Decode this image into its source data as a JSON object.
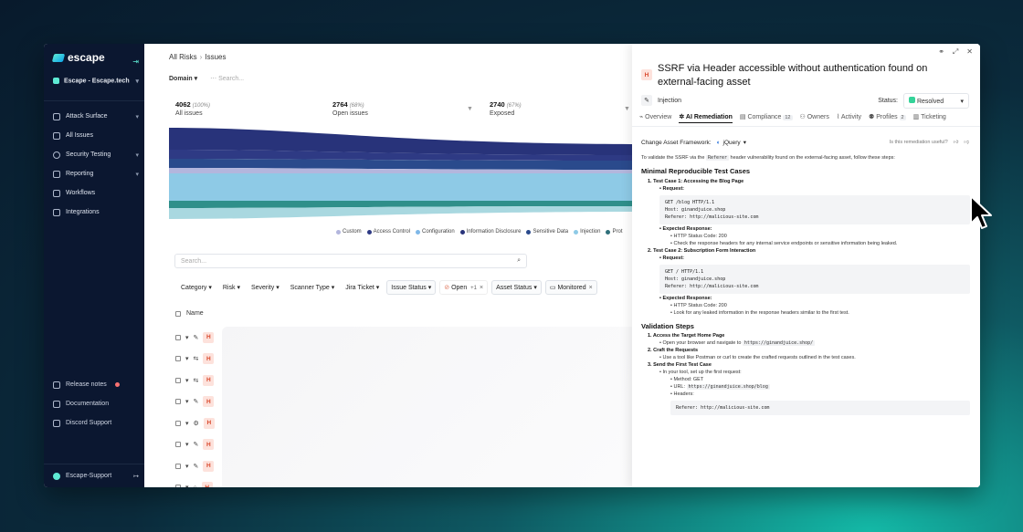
{
  "sidebar": {
    "logo": "escape",
    "org": "Escape - Escape.tech",
    "items": [
      {
        "label": "Attack Surface",
        "chevron": true
      },
      {
        "label": "All Issues",
        "chevron": false
      },
      {
        "label": "Security Testing",
        "chevron": true
      },
      {
        "label": "Reporting",
        "chevron": true
      },
      {
        "label": "Workflows",
        "chevron": false
      },
      {
        "label": "Integrations",
        "chevron": false
      }
    ],
    "bottom": [
      "Release notes",
      "Documentation",
      "Discord Support"
    ],
    "user": "Escape-Support"
  },
  "main": {
    "breadcrumb": [
      "All Risks",
      "Issues"
    ],
    "domain": "Domain",
    "search_placeholder": "Search...",
    "stats": [
      {
        "value": "4062",
        "pct": "(100%)",
        "label": "All issues"
      },
      {
        "value": "2764",
        "pct": "(68%)",
        "label": "Open issues"
      },
      {
        "value": "2740",
        "pct": "(67%)",
        "label": "Exposed"
      }
    ],
    "legend": [
      {
        "label": "Custom",
        "color": "#b3b6dd"
      },
      {
        "label": "Access Control",
        "color": "#2e3a84"
      },
      {
        "label": "Configuration",
        "color": "#7fb8e8"
      },
      {
        "label": "Information Disclosure",
        "color": "#28337a"
      },
      {
        "label": "Sensitive Data",
        "color": "#2a4a8c"
      },
      {
        "label": "Injection",
        "color": "#8ecae6"
      },
      {
        "label": "Prot",
        "color": "#2f6f7a"
      }
    ],
    "table_search_placeholder": "Search...",
    "filters": [
      "Category",
      "Risk",
      "Severity",
      "Scanner Type",
      "Jira Ticket",
      "Issue Status"
    ],
    "open_chip": {
      "label": "Open",
      "badge": "+1"
    },
    "asset_status": "Asset Status",
    "monitored_chip": "Monitored",
    "column_name": "Name",
    "row_badge": "H",
    "row_icons": [
      "✎",
      "⇆",
      "⇆",
      "✎",
      "⚙",
      "✎",
      "✎",
      "⌂"
    ]
  },
  "panel": {
    "severity": "H",
    "title": "SSRF via Header accessible without authentication found on external-facing asset",
    "category": "Injection",
    "status_label": "Status:",
    "status_value": "Resolved",
    "tabs": [
      {
        "label": "Overview",
        "count": ""
      },
      {
        "label": "AI Remediation",
        "count": ""
      },
      {
        "label": "Compliance",
        "count": "12"
      },
      {
        "label": "Owners",
        "count": ""
      },
      {
        "label": "Activity",
        "count": ""
      },
      {
        "label": "Profiles",
        "count": "2"
      },
      {
        "label": "Ticketing",
        "count": ""
      }
    ],
    "framework_label": "Change Asset Framework:",
    "framework_value": "jQuery",
    "useful_q": "Is this remediation useful?",
    "intro_pre": "To validate the SSRF via the",
    "intro_code": "Referer",
    "intro_post": "header vulnerability found on the external-facing asset, follow these steps:",
    "h_minimal": "Minimal Reproducible Test Cases",
    "tc1": "1. Test Case 1: Accessing the Blog Page",
    "request": "Request:",
    "code1": "GET /blog HTTP/1.1\nHost: ginandjuice.shop\nReferer: http://malicious-site.com",
    "expected": "Expected Response:",
    "tc1_resp": [
      "HTTP Status Code: 200",
      "Check the response headers for any internal service endpoints or sensitive information being leaked."
    ],
    "tc2": "2. Test Case 2: Subscription Form Interaction",
    "code2": "GET / HTTP/1.1\nHost: ginandjuice.shop\nReferer: http://malicious-site.com",
    "tc2_resp": [
      "HTTP Status Code: 200",
      "Look for any leaked information in the response headers similar to the first test."
    ],
    "h_validation": "Validation Steps",
    "v1": "1. Access the Target Home Page",
    "v1_text": "Open your browser and navigate to",
    "v1_code": "https://ginandjuice.shop/",
    "v2": "2. Craft the Requests",
    "v2_text": "Use a tool like Postman or curl to create the crafted requests outlined in the test cases.",
    "v3": "3. Send the First Test Case",
    "v3_text": "In your tool, set up the first request:",
    "v3_method": "Method: GET",
    "v3_url_label": "URL:",
    "v3_url": "https://ginandjuice.shop/blog",
    "v3_headers": "Headers:",
    "code3": "Referer: http://malicious-site.com"
  }
}
